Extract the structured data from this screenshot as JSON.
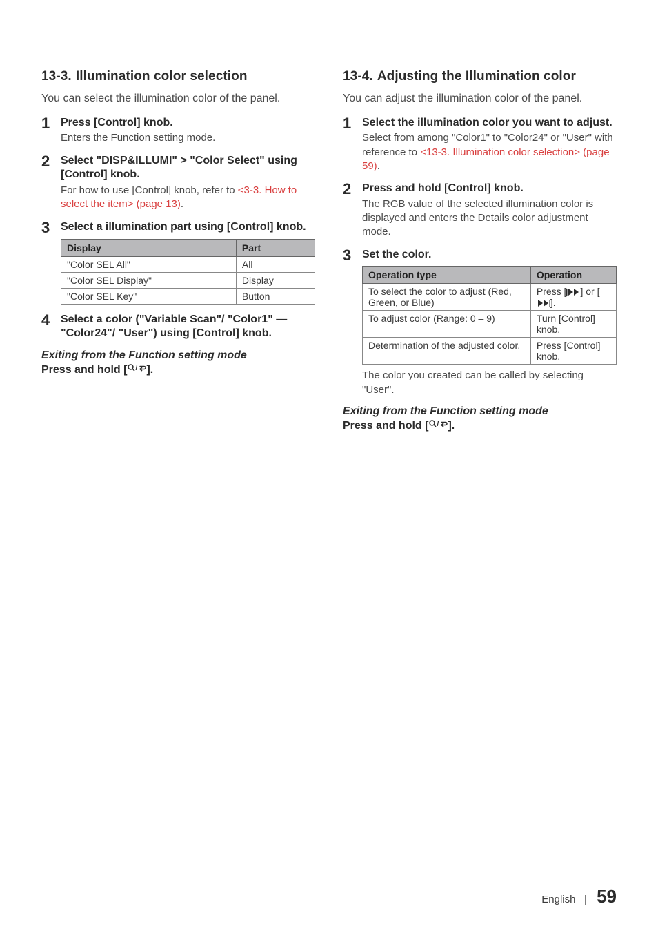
{
  "left": {
    "heading_num": "13-3.",
    "heading_txt": "Illumination color selection",
    "intro": "You can select the illumination color of the panel.",
    "steps": [
      {
        "title": "Press [Control] knob.",
        "body": "Enters the Function setting mode."
      },
      {
        "title_pre": "Select \"DISP&ILLUMI\"",
        "title_chev": ">",
        "title_post": "\"Color Select\" using [Control] knob.",
        "body_pre": "For how to use [Control] knob, refer to ",
        "link": "<3-3. How to select the item> (page 13)",
        "body_post": "."
      },
      {
        "title": "Select a illumination part using [Control] knob."
      },
      {
        "title": "Select a color (\"Variable Scan\"/ \"Color1\" — \"Color24\"/ \"User\") using [Control] knob."
      }
    ],
    "table": {
      "h1": "Display",
      "h2": "Part",
      "rows": [
        {
          "d": "\"Color SEL All\"",
          "p": "All"
        },
        {
          "d": "\"Color SEL Display\"",
          "p": "Display"
        },
        {
          "d": "\"Color SEL Key\"",
          "p": "Button"
        }
      ]
    },
    "exit_hd": "Exiting from the Function setting mode",
    "exit_body_pre": "Press and hold [",
    "exit_body_post": "]."
  },
  "right": {
    "heading_num": "13-4.",
    "heading_txt": "Adjusting the Illumination color",
    "intro": "You can adjust the illumination color of the panel.",
    "steps": [
      {
        "title": "Select the illumination color you want to adjust.",
        "body_pre": "Select from among \"Color1\" to \"Color24\" or \"User\" with reference to ",
        "link": "<13-3. Illumination color selection> (page 59)",
        "body_post": "."
      },
      {
        "title": "Press and hold [Control] knob.",
        "body": "The RGB value of the selected illumination color is displayed and enters the Details color adjustment mode."
      },
      {
        "title": "Set the color."
      }
    ],
    "table": {
      "h1": "Operation type",
      "h2": "Operation",
      "rows": [
        {
          "t": "To select the color to adjust (Red, Green, or Blue)",
          "o_pre": "Press [",
          "o_mid": "] or [",
          "o_post": "]."
        },
        {
          "t": "To adjust color (Range: 0 – 9)",
          "o": "Turn [Control] knob."
        },
        {
          "t": "Determination of the adjusted color.",
          "o": "Press [Control] knob."
        }
      ]
    },
    "after_table": "The color you created can be called by selecting \"User\".",
    "exit_hd": "Exiting from the Function setting mode",
    "exit_body_pre": "Press and hold [",
    "exit_body_post": "]."
  },
  "footer": {
    "lang": "English",
    "sep": "|",
    "page": "59"
  },
  "icons": {
    "search_return": "⌕/↩"
  }
}
